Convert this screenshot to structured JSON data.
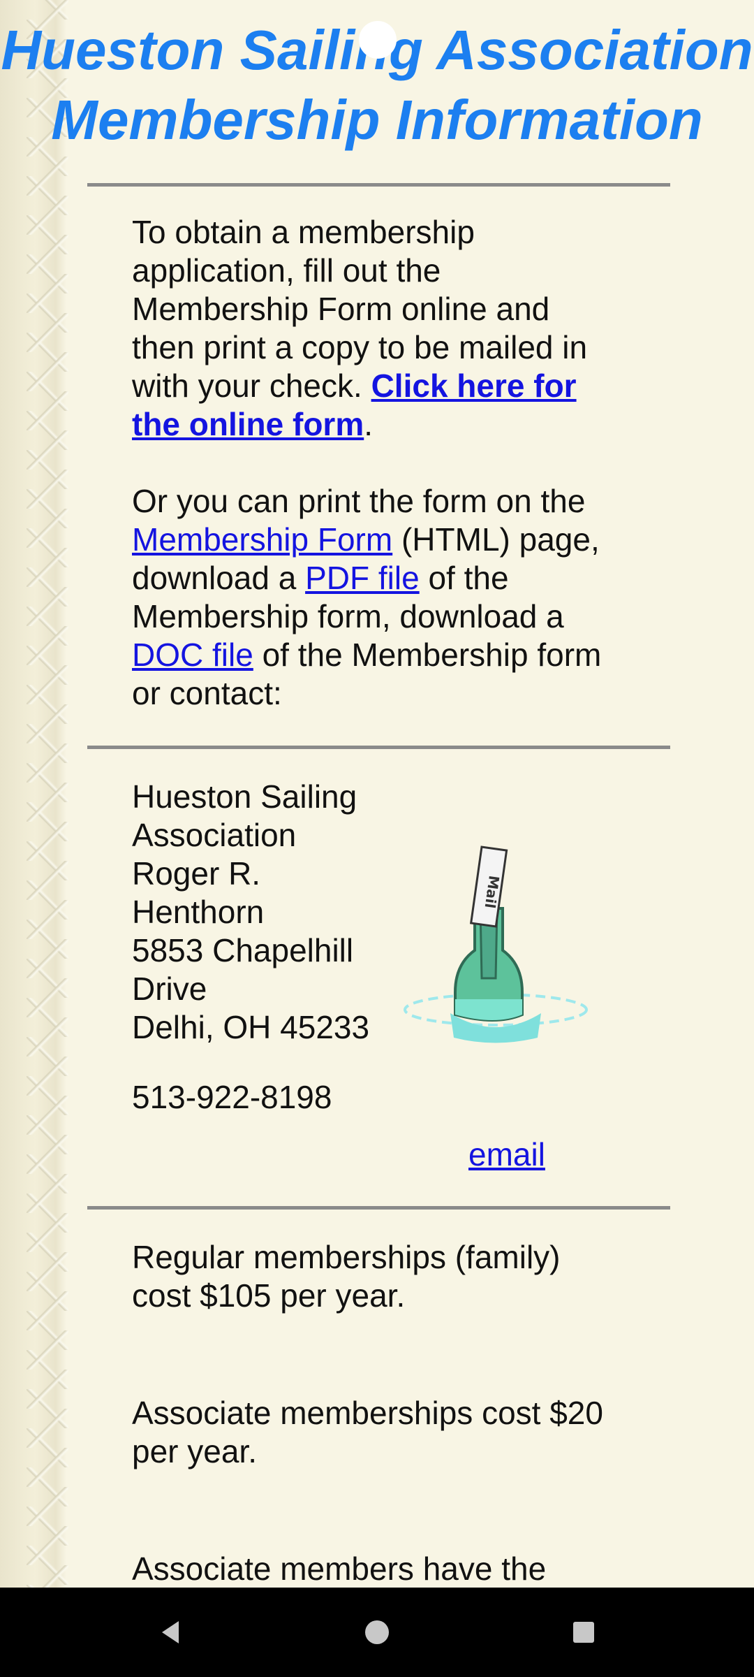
{
  "title": {
    "line1": "Hueston Sailing Association",
    "line2": "Membership Information"
  },
  "intro": {
    "text": "To obtain a membership application, fill out the Membership Form online and then print a copy to be mailed in with your check. ",
    "link_online_form": "Click here for the online form",
    "period": "."
  },
  "alternatives": {
    "text_a": "Or you can print the form on the ",
    "link_membership_form": "Membership Form",
    "text_b": " (HTML) page, download a ",
    "link_pdf": "PDF file",
    "text_c": " of the Membership form, download a ",
    "link_doc": "DOC file",
    "text_d": " of the Membership form or contact:"
  },
  "contact": {
    "address_lines": [
      "Hueston Sailing",
      "Association",
      "Roger R.",
      "Henthorn",
      "5853 Chapelhill",
      "Drive",
      "Delhi, OH 45233"
    ],
    "phone": "513-922-8198",
    "email_link": "email",
    "image_icon": "message-in-bottle-image",
    "image_label": "Mail"
  },
  "fees": {
    "regular": "Regular memberships (family) cost $105 per year.",
    "associate": "Associate memberships cost $20 per year.",
    "associate_rights": "Associate members have the"
  },
  "colors": {
    "title": "#1c7ff0",
    "link": "#1414e0",
    "background": "#f7f4e3",
    "rule": "#8a8a8a"
  },
  "system_nav": {
    "back_icon": "back-triangle-icon",
    "home_icon": "home-circle-icon",
    "recents_icon": "recents-square-icon"
  }
}
